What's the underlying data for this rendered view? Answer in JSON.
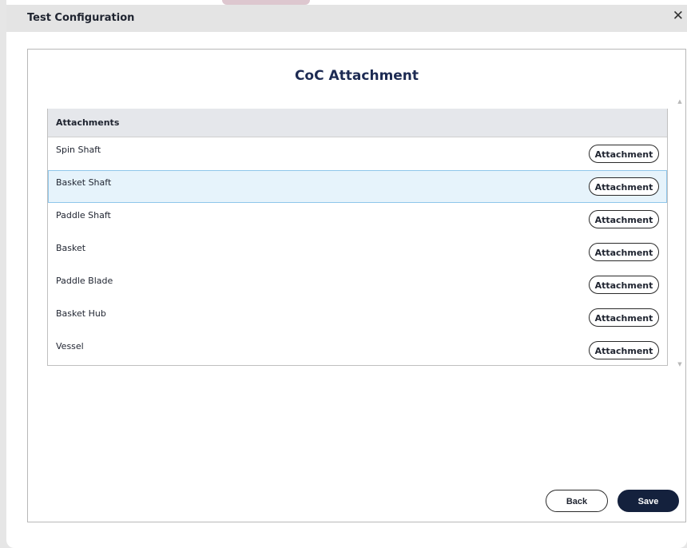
{
  "dialog": {
    "title": "Test Configuration",
    "close_icon": "close-icon",
    "close_glyph": "✕"
  },
  "panel": {
    "title": "CoC Attachment"
  },
  "table": {
    "header": "Attachments",
    "selected_row": "Basket Shaft",
    "rows": [
      {
        "label": "Spin Shaft",
        "button": "Attachment"
      },
      {
        "label": "Basket Shaft",
        "button": "Attachment"
      },
      {
        "label": "Paddle Shaft",
        "button": "Attachment"
      },
      {
        "label": "Basket",
        "button": "Attachment"
      },
      {
        "label": "Paddle Blade",
        "button": "Attachment"
      },
      {
        "label": "Basket Hub",
        "button": "Attachment"
      },
      {
        "label": "Vessel",
        "button": "Attachment"
      }
    ]
  },
  "scrollbar": {
    "up_icon": "scroll-up-arrow-icon",
    "down_icon": "scroll-down-arrow-icon",
    "up_glyph": "▲",
    "down_glyph": "▼"
  },
  "footer": {
    "back_label": "Back",
    "save_label": "Save"
  },
  "colors": {
    "primary": "#14213d",
    "title_text": "#1d2b53",
    "selected_row_bg": "#e6f3fb",
    "selected_row_border": "#8fc6ea",
    "header_bg": "#e5e7eb"
  }
}
